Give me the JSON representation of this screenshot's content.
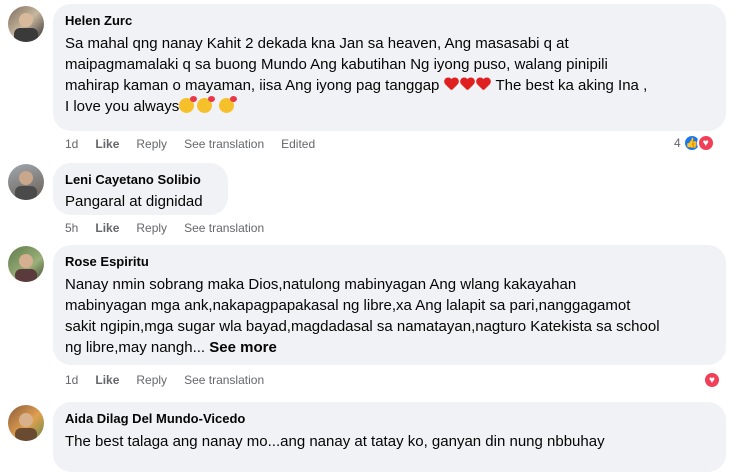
{
  "comments": [
    {
      "author": "Helen Zurc",
      "text": "Sa mahal qng nanay Kahit 2 dekada kna Jan sa heaven, Ang masasabi q at\nmaipagmamalaki q sa buong Mundo Ang kabutihan Ng iyong puso, walang pinipili\nmahirap kaman o mayaman, iisa Ang iyong pag tanggap",
      "text_after_hearts": " The best ka aking Ina ,",
      "text_line4": "I love you always",
      "time": "1d",
      "like": "Like",
      "reply": "Reply",
      "translate": "See translation",
      "edited": "Edited",
      "reaction_count": "4"
    },
    {
      "author": "Leni Cayetano Solibio",
      "text": "Pangaral at dignidad",
      "time": "5h",
      "like": "Like",
      "reply": "Reply",
      "translate": "See translation"
    },
    {
      "author": "Rose Espiritu",
      "text": "Nanay nmin sobrang maka Dios,natulong mabinyagan Ang wlang kakayahan\nmabinyagan mga ank,nakapagpapakasal ng libre,xa Ang lalapit sa pari,nanggagamot\nsakit ngipin,mga sugar wla bayad,magdadasal sa namatayan,nagturo Katekista sa school\nng libre,may nangh...",
      "see_more": "See more",
      "time": "1d",
      "like": "Like",
      "reply": "Reply",
      "translate": "See translation"
    },
    {
      "author": "Aida Dilag Del Mundo-Vicedo",
      "text": "The best talaga ang nanay mo...ang nanay at tatay ko, ganyan din nung nbbuhay"
    }
  ],
  "icons": {
    "heart": "heart-icon",
    "like_reaction": "like-reaction-icon",
    "love_reaction": "love-reaction-icon",
    "smiling_hearts": "smiling-face-with-hearts-icon"
  },
  "colors": {
    "bubble": "#f0f2f5",
    "meta": "#65676b",
    "like_blue": "#1877f2",
    "love_red": "#f33e58"
  }
}
